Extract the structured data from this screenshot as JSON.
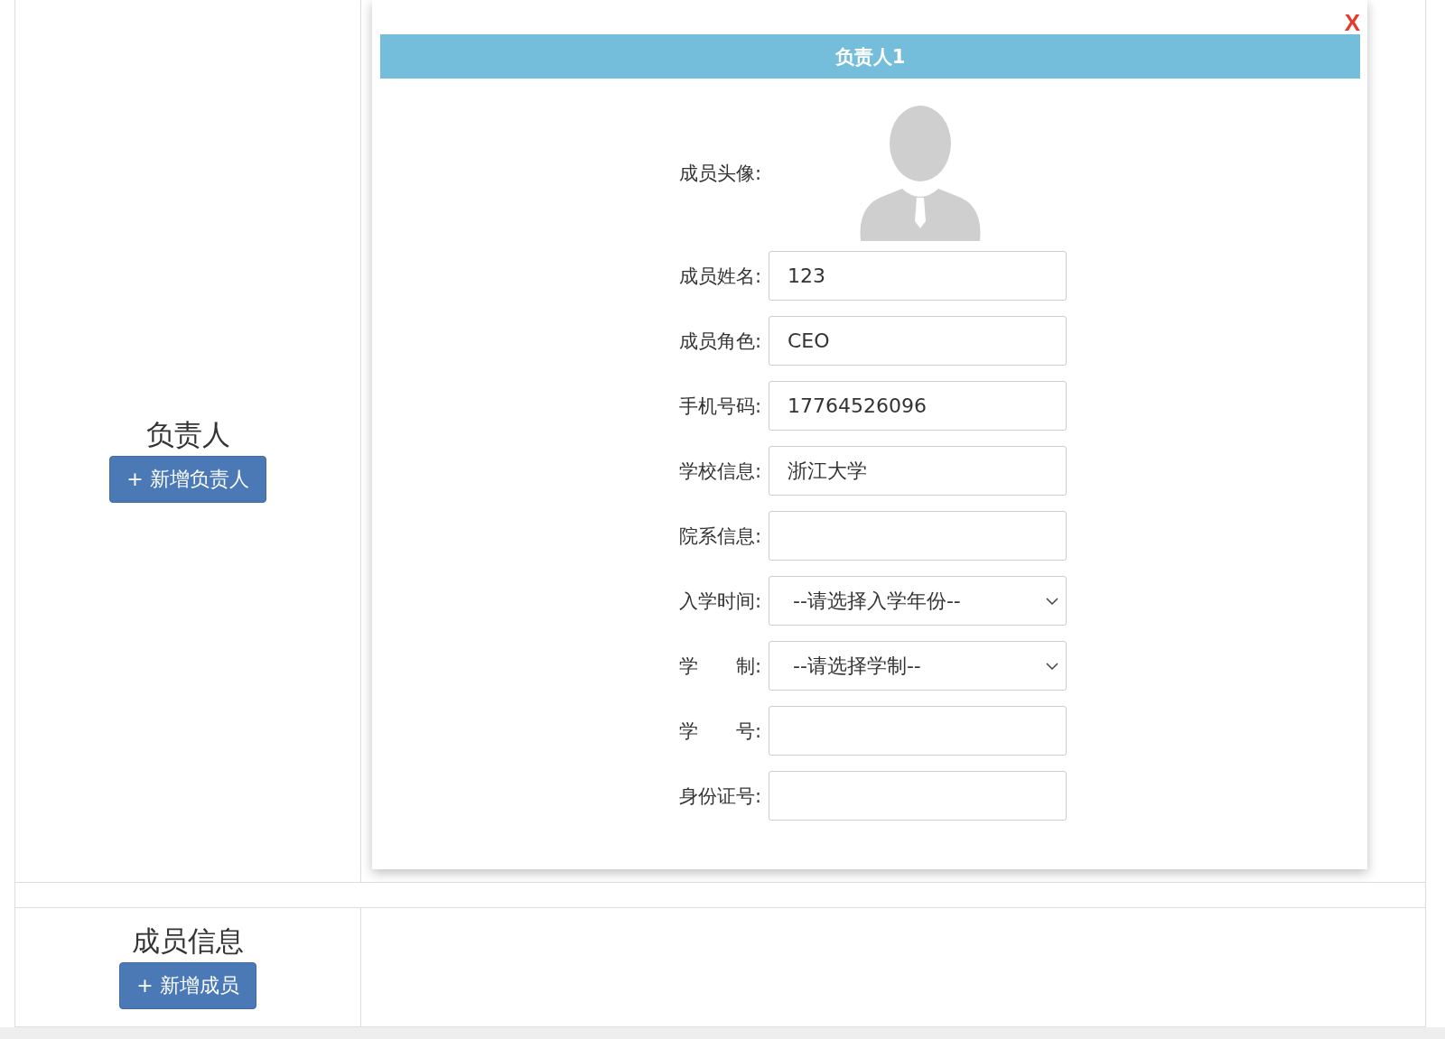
{
  "sections": [
    {
      "title": "负责人",
      "button": "+ 新增负责人"
    },
    {
      "title": "成员信息",
      "button": "+ 新增成员"
    }
  ],
  "dialog": {
    "title": "负责人1",
    "close": "X",
    "avatar_label": "成员头像:",
    "fields": [
      {
        "kind": "input",
        "label": "成员姓名:",
        "value": "123"
      },
      {
        "kind": "input",
        "label": "成员角色:",
        "value": "CEO"
      },
      {
        "kind": "input",
        "label": "手机号码:",
        "value": "17764526096"
      },
      {
        "kind": "input",
        "label": "学校信息:",
        "value": "浙江大学"
      },
      {
        "kind": "input",
        "label": "院系信息:"
      },
      {
        "kind": "select",
        "label": "入学时间:",
        "value": "--请选择入学年份--"
      },
      {
        "kind": "select",
        "label": "学　　制:",
        "value": "--请选择学制--"
      },
      {
        "kind": "input",
        "label": "学　　号:"
      },
      {
        "kind": "input",
        "label": "身份证号:"
      }
    ]
  }
}
